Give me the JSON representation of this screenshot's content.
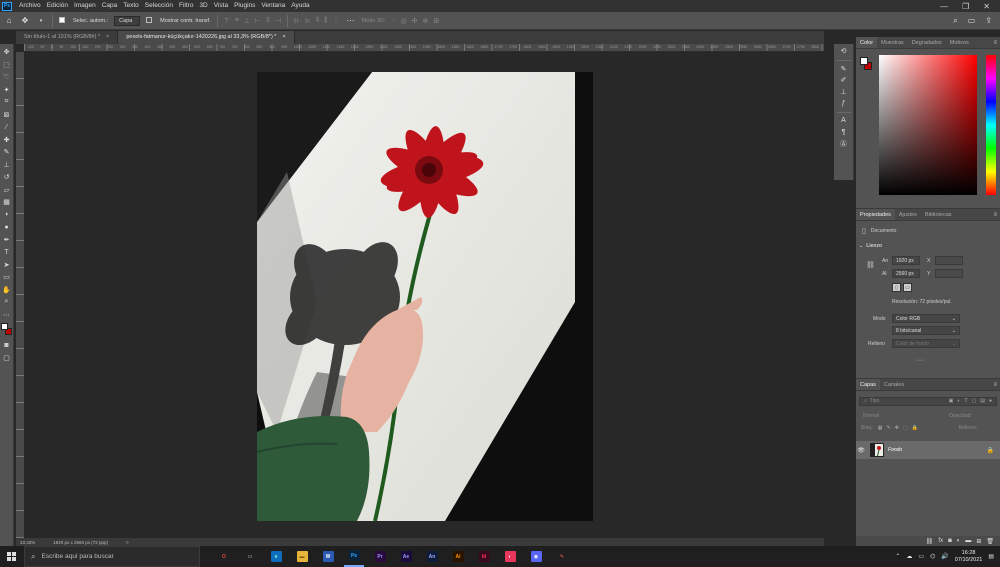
{
  "menu": {
    "items": [
      "Archivo",
      "Edición",
      "Imagen",
      "Capa",
      "Texto",
      "Selección",
      "Filtro",
      "3D",
      "Vista",
      "Plugins",
      "Ventana",
      "Ayuda"
    ],
    "logo": "Ps"
  },
  "options": {
    "auto_select_label": "Selec. autom.:",
    "auto_select_value": "Capa",
    "transform_label": "Mostrar contr. transf.",
    "mode_3d_label": "Modo 3D:"
  },
  "tabs": [
    {
      "label": "Sin título-1 al 101% (RGB/8#) *",
      "active": false
    },
    {
      "label": "pexels-fatmanur-küçükçakır-1420226.jpg al 33,3% (RGB/8*) *",
      "active": true
    }
  ],
  "ruler": {
    "ticks": [
      "100",
      "50",
      "0",
      "50",
      "100",
      "150",
      "200",
      "250",
      "300",
      "350",
      "400",
      "450",
      "500",
      "550",
      "600",
      "650",
      "700",
      "750",
      "800",
      "850",
      "900",
      "950",
      "1000",
      "1050",
      "1100",
      "1150",
      "1200",
      "1250",
      "1300",
      "1350",
      "1400",
      "1450",
      "1500",
      "1550",
      "1600",
      "1650",
      "1700",
      "1750",
      "1800",
      "1850",
      "1900",
      "1950",
      "2000",
      "2050",
      "2100",
      "2150",
      "2200",
      "2250",
      "2300",
      "2350",
      "2400",
      "2450",
      "2500",
      "2550",
      "2600",
      "2650",
      "2700",
      "2750",
      "2800"
    ]
  },
  "status": {
    "zoom": "33,33%",
    "dims": "1920 px x 2560 px (72 ppp)",
    "arrow": ">"
  },
  "color_panel": {
    "tabs": [
      "Color",
      "Muestras",
      "Degradados",
      "Motivos"
    ],
    "fg_color": "#ffffff",
    "bg_color": "#c00000"
  },
  "properties": {
    "tabs": [
      "Propiedades",
      "Ajustes",
      "Bibliotecas"
    ],
    "doc_label": "Documento",
    "section": "Lienzo",
    "w_label": "An",
    "w_value": "1920 px",
    "h_label": "Al",
    "h_value": "2560 px",
    "x_label": "X",
    "y_label": "Y",
    "resolution": "Resolución: 72 píxeles/pul.",
    "mode_label": "Modo",
    "mode_value": "Color RGB",
    "bits_value": "8 bits/canal",
    "fill_label": "Relleno",
    "fill_value": "Color de fondo"
  },
  "layers": {
    "tabs": [
      "Capas",
      "Canales"
    ],
    "search_placeholder": "Tipo",
    "blend_mode": "Normal",
    "opacity_label": "Opacidad:",
    "lock_label": "Bloq.:",
    "fill_label": "Relleno:",
    "layer_name": "Fondo"
  },
  "taskbar": {
    "search_placeholder": "Escribe aquí para buscar",
    "apps": [
      {
        "label": "O",
        "bg": "#1f1f1f",
        "fg": "#e04a3f",
        "name": "cortana"
      },
      {
        "label": "▭",
        "bg": "#1f1f1f",
        "fg": "#dddddd",
        "name": "task-view"
      },
      {
        "label": "e",
        "bg": "#0f6cbd",
        "fg": "#7fffd4",
        "name": "edge"
      },
      {
        "label": "▬",
        "bg": "#e8b339",
        "fg": "#7a5a10",
        "name": "explorer"
      },
      {
        "label": "W",
        "bg": "#2b5ab4",
        "fg": "#ffffff",
        "name": "word"
      },
      {
        "label": "Ps",
        "bg": "#0b2338",
        "fg": "#31a8ff",
        "name": "photoshop"
      },
      {
        "label": "Pr",
        "bg": "#2a0a3a",
        "fg": "#9999ff",
        "name": "premiere"
      },
      {
        "label": "Ae",
        "bg": "#1a0b3a",
        "fg": "#9999ff",
        "name": "after-effects"
      },
      {
        "label": "An",
        "bg": "#0d1c3a",
        "fg": "#9aa8ff",
        "name": "animate"
      },
      {
        "label": "Ai",
        "bg": "#2a1400",
        "fg": "#ff9a00",
        "name": "illustrator"
      },
      {
        "label": "Id",
        "bg": "#3a0a1e",
        "fg": "#ff3366",
        "name": "indesign"
      },
      {
        "label": "◐",
        "bg": "#e8365d",
        "fg": "#ffffff",
        "name": "app-pink"
      },
      {
        "label": "◉",
        "bg": "#5865f2",
        "fg": "#ffffff",
        "name": "discord"
      },
      {
        "label": "✎",
        "bg": "#1f1f1f",
        "fg": "#ff5c5c",
        "name": "snip"
      }
    ],
    "time": "16:28",
    "date": "07/10/2021"
  }
}
